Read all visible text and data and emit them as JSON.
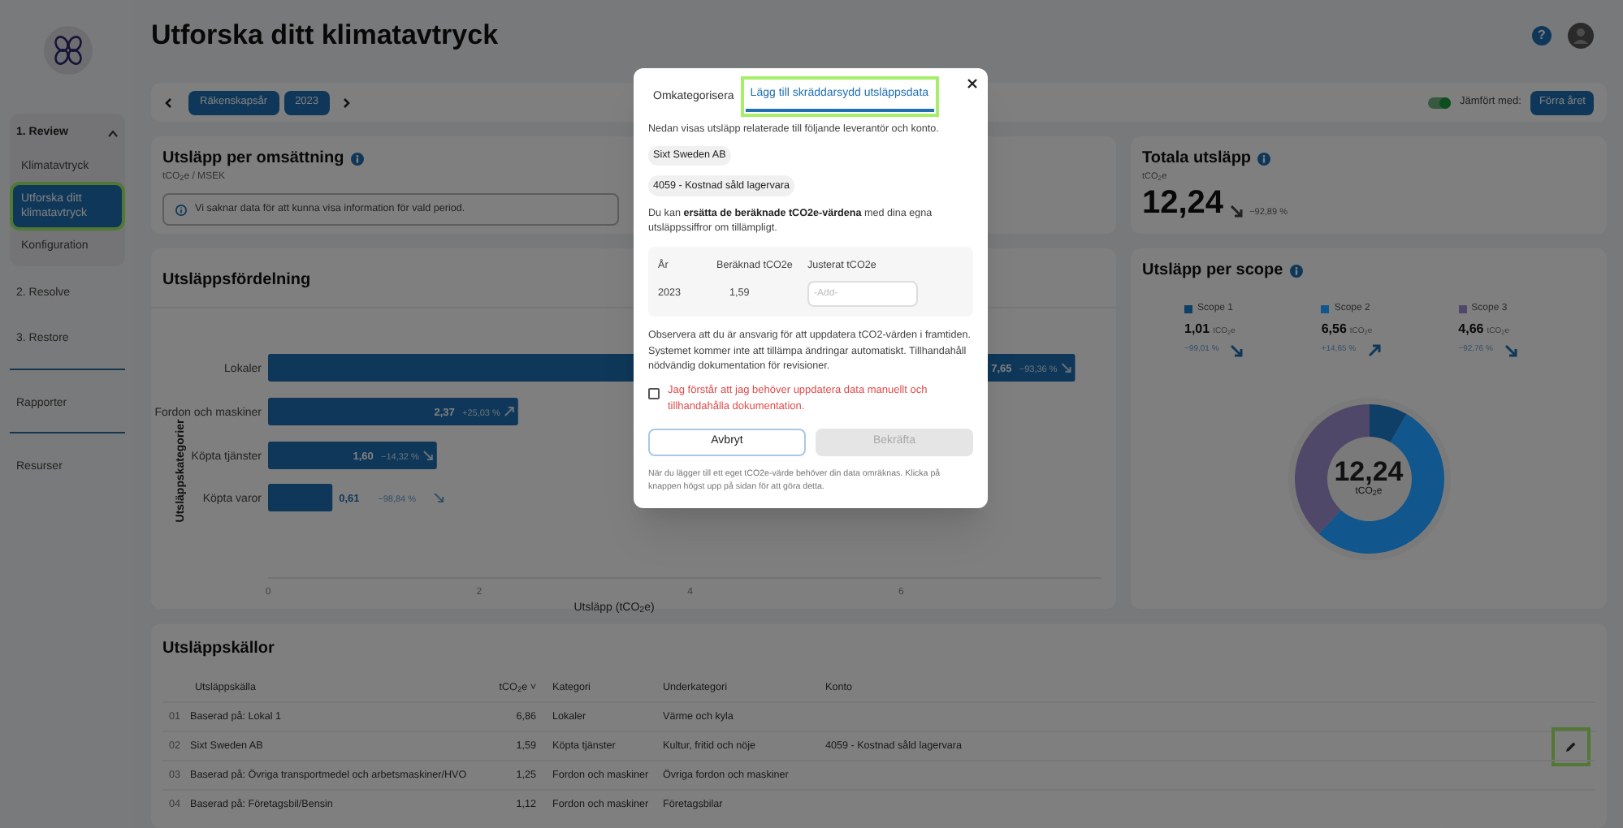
{
  "page": {
    "title": "Utforska ditt klimatavtryck"
  },
  "sidebar": {
    "items": [
      {
        "label": "1. Review",
        "expanded": true,
        "children": [
          {
            "label": "Klimatavtryck",
            "selected": false
          },
          {
            "label": "Utforska ditt klimatavtryck",
            "selected": true
          },
          {
            "label": "Konfiguration",
            "selected": false
          }
        ]
      },
      {
        "label": "2. Resolve",
        "divider_after": false
      },
      {
        "label": "3. Restore",
        "divider_after": true
      },
      {
        "label": "Rapporter",
        "divider_after": true
      },
      {
        "label": "Resurser",
        "divider_after": false
      }
    ]
  },
  "header": {
    "help": "?"
  },
  "period": {
    "chips": [
      "Räkenskapsår",
      "2023"
    ],
    "compare_on": true,
    "compare_label": "Jämfört med:",
    "compare_button": "Förra året"
  },
  "per_revenue": {
    "title": "Utsläpp per omsättning",
    "unit": "tCO$_{2}$e / MSEK",
    "notice": "Vi saknar data för att kunna visa information för vald period."
  },
  "total": {
    "title": "Totala utsläpp",
    "unit": "tCO$_{2}$e",
    "value": "12,24",
    "rising": false,
    "change": "−92,89 %"
  },
  "distribution": {
    "title": "Utsläppsfördelning",
    "changes": [
      {
        "text": "−93,36 %",
        "rising": false
      },
      {
        "text": "+25,03 %",
        "rising": true
      },
      {
        "text": "−14,32 %",
        "rising": false
      },
      {
        "text": "−98,84 %",
        "rising": false
      }
    ],
    "chart_data": {
      "type": "bar",
      "orientation": "horizontal",
      "xlabel": "Utsläpp (tCO$_{2}$e)",
      "ylabel": "Utsläppskategorier",
      "categories": [
        "Lokaler",
        "Fordon och maskiner",
        "Köpta tjänster",
        "Köpta varor"
      ],
      "values": [
        7.65,
        2.37,
        1.6,
        0.61
      ],
      "xlim": [
        0,
        7.9
      ],
      "xticks": [
        0,
        2,
        4,
        6
      ],
      "value_labels": [
        "7,65",
        "2,37",
        "1,60",
        "0,61"
      ]
    }
  },
  "scopes": {
    "title": "Utsläpp per scope",
    "items": [
      {
        "value": "1,01",
        "unit": "tCO$_{2}$e",
        "change": "−99,01 %",
        "rising": false,
        "color": "#0f3f66"
      },
      {
        "value": "6,56",
        "unit": "tCO$_{2}$e",
        "change": "+14,65 %",
        "rising": true,
        "color": "#11568c"
      },
      {
        "value": "4,66",
        "unit": "tCO$_{2}$e",
        "change": "−92,76 %",
        "rising": false,
        "color": "#4f4868"
      }
    ],
    "center_value": "12,24",
    "center_unit": "tCO$_{2}$e",
    "chart_data": {
      "type": "donut",
      "categories": [
        "Scope 1",
        "Scope 2",
        "Scope 3"
      ],
      "values": [
        1.01,
        6.56,
        4.66
      ]
    }
  },
  "sources": {
    "title": "Utsläppskällor",
    "columns": [
      "Utsläppskälla",
      "tCO$_{2}$e ˅",
      "Kategori",
      "Underkategori",
      "Konto"
    ],
    "rows": [
      {
        "index": "01",
        "source": "Baserad på: Lokal 1",
        "value": "6,86",
        "category": "Lokaler",
        "subcategory": "Värme och kyla",
        "editable": false
      },
      {
        "index": "02",
        "source": "Sixt Sweden AB",
        "value": "1,59",
        "category": "Köpta tjänster",
        "subcategory": "Kultur, fritid och nöje",
        "account": "4059 - Kostnad såld lagervara",
        "editable": true
      },
      {
        "index": "03",
        "source": "Baserad på: Övriga transportmedel och arbetsmaskiner/HVO",
        "value": "1,25",
        "category": "Fordon och maskiner",
        "subcategory": "Övriga fordon och maskiner",
        "editable": false
      },
      {
        "index": "04",
        "source": "Baserad på: Företagsbil/Bensin",
        "value": "1,12",
        "category": "Fordon och maskiner",
        "subcategory": "Företagsbilar",
        "editable": false
      }
    ]
  },
  "modal": {
    "tabs": [
      {
        "label": "Omkategorisera",
        "selected": false
      },
      {
        "label": "Lägg till skräddarsydd utsläppsdata",
        "selected": true
      }
    ],
    "intro": "Nedan visas utsläpp relaterade till följande leverantör och konto.",
    "chips": [
      "Sixt Sweden AB",
      "4059 - Kostnad såld lagervara"
    ],
    "replace_text": "Du kan **ersätta de beräknade tCO2e-värdena** med dina egna utsläppssiffror om tillämpligt.",
    "table": {
      "columns": [
        "År",
        "Beräknad tCO2e",
        "Justerat tCO2e"
      ],
      "rows": [
        {
          "year": "2023",
          "calculated": "1,59",
          "placeholder": "-Add-"
        }
      ]
    },
    "notice": "Observera att du är ansvarig för att uppdatera tCO2-värden i framtiden. Systemet kommer inte att tillämpa ändringar automatiskt. Tillhandahåll nödvändig dokumentation för revisioner.",
    "confirm": {
      "label": "Jag förstår att jag behöver uppdatera data manuellt och tillhandahålla dokumentation.",
      "checked": false
    },
    "buttons": [
      {
        "label": "Avbryt",
        "disabled": false
      },
      {
        "label": "Bekräfta",
        "disabled": true
      }
    ],
    "footnote": "När du lägger till ett eget tCO2e-värde behöver din data omräknas. Klicka på knappen högst upp på sidan för att göra detta."
  }
}
